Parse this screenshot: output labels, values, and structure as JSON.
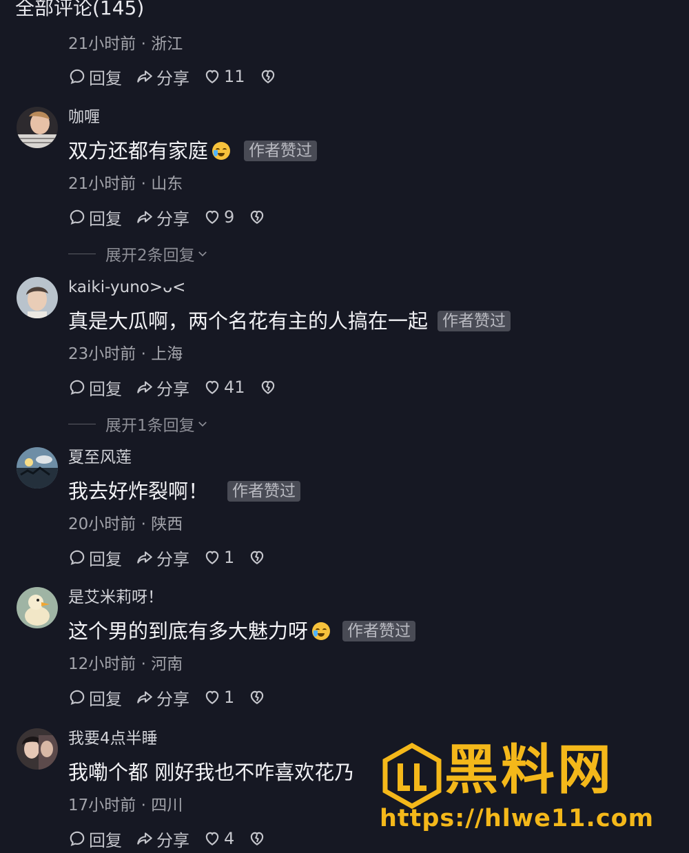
{
  "header": {
    "title": "全部评论(145)"
  },
  "labels": {
    "reply": "回复",
    "share": "分享",
    "author_liked": "作者赞过"
  },
  "first_block": {
    "meta": "21小时前 · 浙江",
    "likes": "11"
  },
  "comments": [
    {
      "username": "咖喱",
      "text": "双方还都有家庭",
      "emoji": "crying-laughing",
      "meta": "21小时前 · 山东",
      "likes": "9",
      "expand": "展开2条回复"
    },
    {
      "username": "kaiki-yuno>ᴗ<",
      "text": "真是大瓜啊，两个名花有主的人搞在一起",
      "meta": "23小时前 · 上海",
      "likes": "41",
      "expand": "展开1条回复"
    },
    {
      "username": "夏至风莲",
      "text": "我去好炸裂啊！",
      "meta": "20小时前 · 陕西",
      "likes": "1"
    },
    {
      "username": "是艾米莉呀！",
      "text": "这个男的到底有多大魅力呀",
      "emoji": "crying-laughing",
      "meta": "12小时前 · 河南",
      "likes": "1"
    },
    {
      "username": "我要4点半睡",
      "text": "我嘞个都 刚好我也不咋喜欢花乃",
      "meta": "17小时前 · 四川",
      "likes": "4"
    }
  ],
  "watermark": {
    "name": "黑料网",
    "url": "https://hlwe11.com"
  },
  "colors": {
    "background": "#161823",
    "badge": "#494b55",
    "watermark": "#f4b81a"
  }
}
